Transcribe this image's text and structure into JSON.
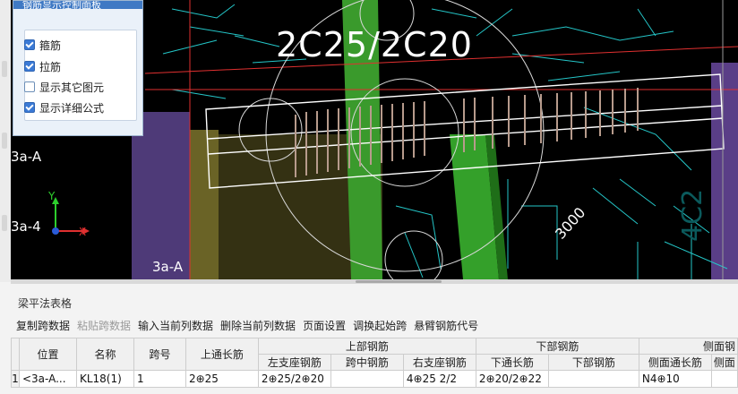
{
  "panel": {
    "title": "钢筋显示控制面板",
    "options": [
      {
        "label": "箍筋",
        "checked": true
      },
      {
        "label": "拉筋",
        "checked": true
      },
      {
        "label": "显示其它图元",
        "checked": false
      },
      {
        "label": "显示详细公式",
        "checked": true
      }
    ]
  },
  "viewport": {
    "annotation": "2C25/2C20",
    "dimension": "3000",
    "axis_labels": [
      "3a-A",
      "3a-4",
      "3a-A"
    ],
    "axis_x": "X",
    "axis_y": "Y",
    "faint_text": [
      "4C2"
    ]
  },
  "table_section": {
    "title": "梁平法表格",
    "toolbar": [
      {
        "label": "复制跨数据",
        "enabled": true
      },
      {
        "label": "粘贴跨数据",
        "enabled": false
      },
      {
        "label": "输入当前列数据",
        "enabled": true
      },
      {
        "label": "删除当前列数据",
        "enabled": true
      },
      {
        "label": "页面设置",
        "enabled": true
      },
      {
        "label": "调换起始跨",
        "enabled": true
      },
      {
        "label": "悬臂钢筋代号",
        "enabled": true
      }
    ],
    "headers": {
      "position": "位置",
      "name": "名称",
      "span": "跨号",
      "top_through": "上通长筋",
      "upper_group": "上部钢筋",
      "lower_group": "下部钢筋",
      "side_group": "侧面钢",
      "left_support": "左支座钢筋",
      "mid_span": "跨中钢筋",
      "right_support": "右支座钢筋",
      "bottom_through": "下通长筋",
      "bottom_rebar": "下部钢筋",
      "side_through": "侧面通长筋",
      "side_extra": "侧面"
    },
    "rows": [
      {
        "index": "1",
        "position": "<3a-A...",
        "name": "KL18(1)",
        "span": "1",
        "top_through": "2⊕25",
        "left_support": "2⊕25/2⊕20",
        "mid_span": "",
        "right_support": "4⊕25 2/2",
        "bottom_through": "2⊕20/2⊕22",
        "bottom_rebar": "",
        "side_through": "N4⊕10",
        "side_extra": ""
      }
    ]
  },
  "colors": {
    "viewport_bg": "#000000",
    "panel_titlebar": "#3f79c4",
    "column_green": "#3a9a2c",
    "column_yellow": "#6a6326",
    "column_purple": "#5a3e87",
    "rebar_cyan": "#24c6c8",
    "axis_red": "#e03030",
    "rebar_stirrup": "#b79b8c"
  }
}
